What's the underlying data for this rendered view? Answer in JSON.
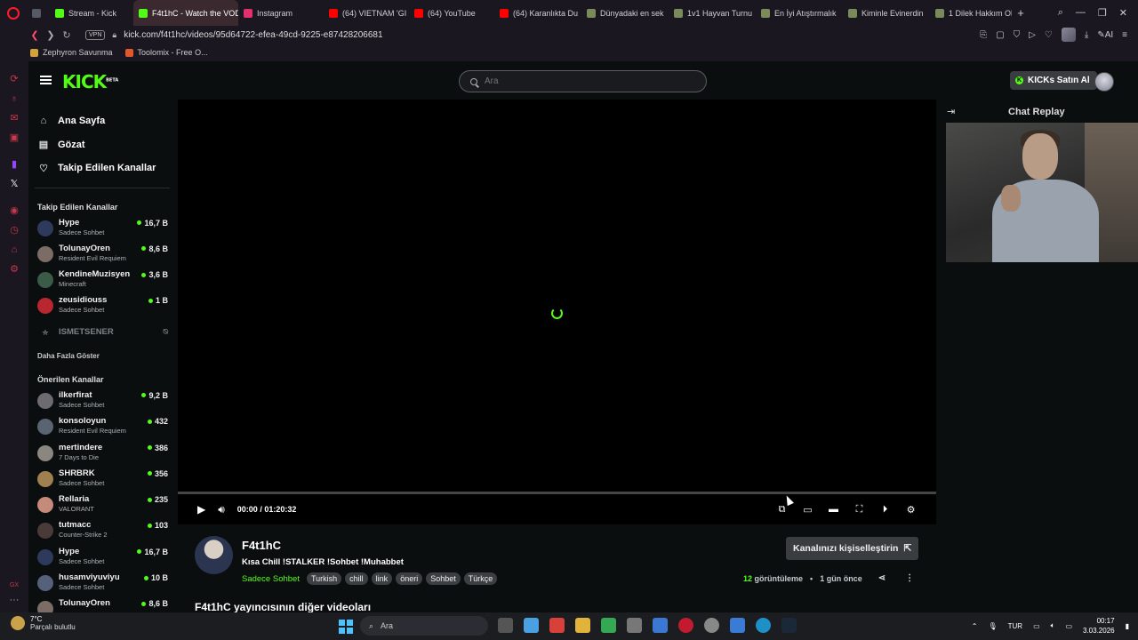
{
  "browser": {
    "tabs": [
      {
        "label": "",
        "favicon_color": "#555a66"
      },
      {
        "label": "Stream - Kick",
        "favicon_color": "#53fc18"
      },
      {
        "label": "F4t1hC - Watch the VOD",
        "favicon_color": "#53fc18",
        "active": true
      },
      {
        "label": "Instagram",
        "favicon_color": "#e1306c"
      },
      {
        "label": "(64) VIETNAM 'GI",
        "favicon_color": "#ff0000"
      },
      {
        "label": "(64) YouTube",
        "favicon_color": "#ff0000"
      },
      {
        "label": "(64) Karanlıkta Du",
        "favicon_color": "#ff0000"
      },
      {
        "label": "Dünyadaki en sek",
        "favicon_color": "#7a8a5a"
      },
      {
        "label": "1v1 Hayvan Turnu",
        "favicon_color": "#7a8a5a"
      },
      {
        "label": "En İyi Atıştırmalık",
        "favicon_color": "#7a8a5a"
      },
      {
        "label": "Kiminle Evinerdin",
        "favicon_color": "#7a8a5a"
      },
      {
        "label": "1 Dilek Hakkım Ols",
        "favicon_color": "#7a8a5a"
      }
    ],
    "new_tab_icon": "plus-icon",
    "vpn_label": "VPN",
    "url": "kick.com/f4t1hc/videos/95d64722-efea-49cd-9225-e87428206681",
    "ai_label": "AI",
    "bookmarks": [
      {
        "label": "Zephyron Savunma",
        "favicon_color": "#d4a23a"
      },
      {
        "label": "Toolomix - Free O...",
        "favicon_color": "#e0582b"
      }
    ]
  },
  "kick": {
    "logo_text": "KICK",
    "logo_badge": "BETA",
    "search_placeholder": "Ara",
    "buy_kicks_label": "KICKs Satın Al",
    "nav": [
      {
        "label": "Ana Sayfa",
        "icon": "home-icon"
      },
      {
        "label": "Gözat",
        "icon": "browse-icon"
      },
      {
        "label": "Takip Edilen Kanallar",
        "icon": "heart-icon"
      }
    ],
    "followed_title": "Takip Edilen Kanallar",
    "followed": [
      {
        "name": "Hype",
        "category": "Sadece Sohbet",
        "viewers": "16,7 B",
        "avatar_color": "#2e3a5c"
      },
      {
        "name": "TolunayOren",
        "category": "Resident Evil Requiem",
        "viewers": "8,6 B",
        "avatar_color": "#7b6c66"
      },
      {
        "name": "KendineMuzisyen",
        "category": "Minecraft",
        "viewers": "3,6 B",
        "avatar_color": "#3c5a48"
      },
      {
        "name": "zeusidiouss",
        "category": "Sadece Sohbet",
        "viewers": "1 B",
        "avatar_color": "#b8262f"
      }
    ],
    "offline_channel": "ISMETSENER",
    "show_more": "Daha Fazla Göster",
    "recommended_title": "Önerilen Kanallar",
    "recommended": [
      {
        "name": "ilkerfirat",
        "category": "Sadece Sohbet",
        "viewers": "9,2 B",
        "avatar_color": "#6d6a70"
      },
      {
        "name": "konsoloyun",
        "category": "Resident Evil Requiem",
        "viewers": "432",
        "avatar_color": "#5a6470"
      },
      {
        "name": "mertindere",
        "category": "7 Days to Die",
        "viewers": "386",
        "avatar_color": "#8a8780"
      },
      {
        "name": "SHRBRK",
        "category": "Sadece Sohbet",
        "viewers": "356",
        "avatar_color": "#a08050"
      },
      {
        "name": "Rellaria",
        "category": "VALORANT",
        "viewers": "235",
        "avatar_color": "#c48a7a"
      },
      {
        "name": "tutmacc",
        "category": "Counter-Strike 2",
        "viewers": "103",
        "avatar_color": "#4a3a3a"
      },
      {
        "name": "Hype",
        "category": "Sadece Sohbet",
        "viewers": "16,7 B",
        "avatar_color": "#2e3a5c"
      },
      {
        "name": "husamviyuviyu",
        "category": "Sadece Sohbet",
        "viewers": "10 B",
        "avatar_color": "#55607a"
      },
      {
        "name": "TolunayOren",
        "category": "",
        "viewers": "8,6 B",
        "avatar_color": "#7b6c66"
      }
    ],
    "player": {
      "time": "00:00 / 01:20:32",
      "progress": 0
    },
    "stream": {
      "channel": "F4t1hC",
      "title": "Kısa Chill !STALKER !Sohbet !Muhabbet",
      "category": "Sadece Sohbet",
      "tags": [
        "Turkish",
        "chill",
        "link",
        "öneri",
        "Sohbet",
        "Türkçe"
      ],
      "personalize_label": "Kanalınızı kişiselleştirin",
      "views_count": "12",
      "views_label": "görüntüleme",
      "separator": "•",
      "posted": "1 gün önce",
      "other_videos": "F4t1hC yayıncısının diğer videoları"
    },
    "chat": {
      "title": "Chat Replay"
    }
  },
  "taskbar": {
    "temperature": "7°C",
    "weather": "Parçalı bulutlu",
    "search_placeholder": "Ara",
    "language": "TUR",
    "time": "00:17",
    "date": "3.03.2026"
  }
}
